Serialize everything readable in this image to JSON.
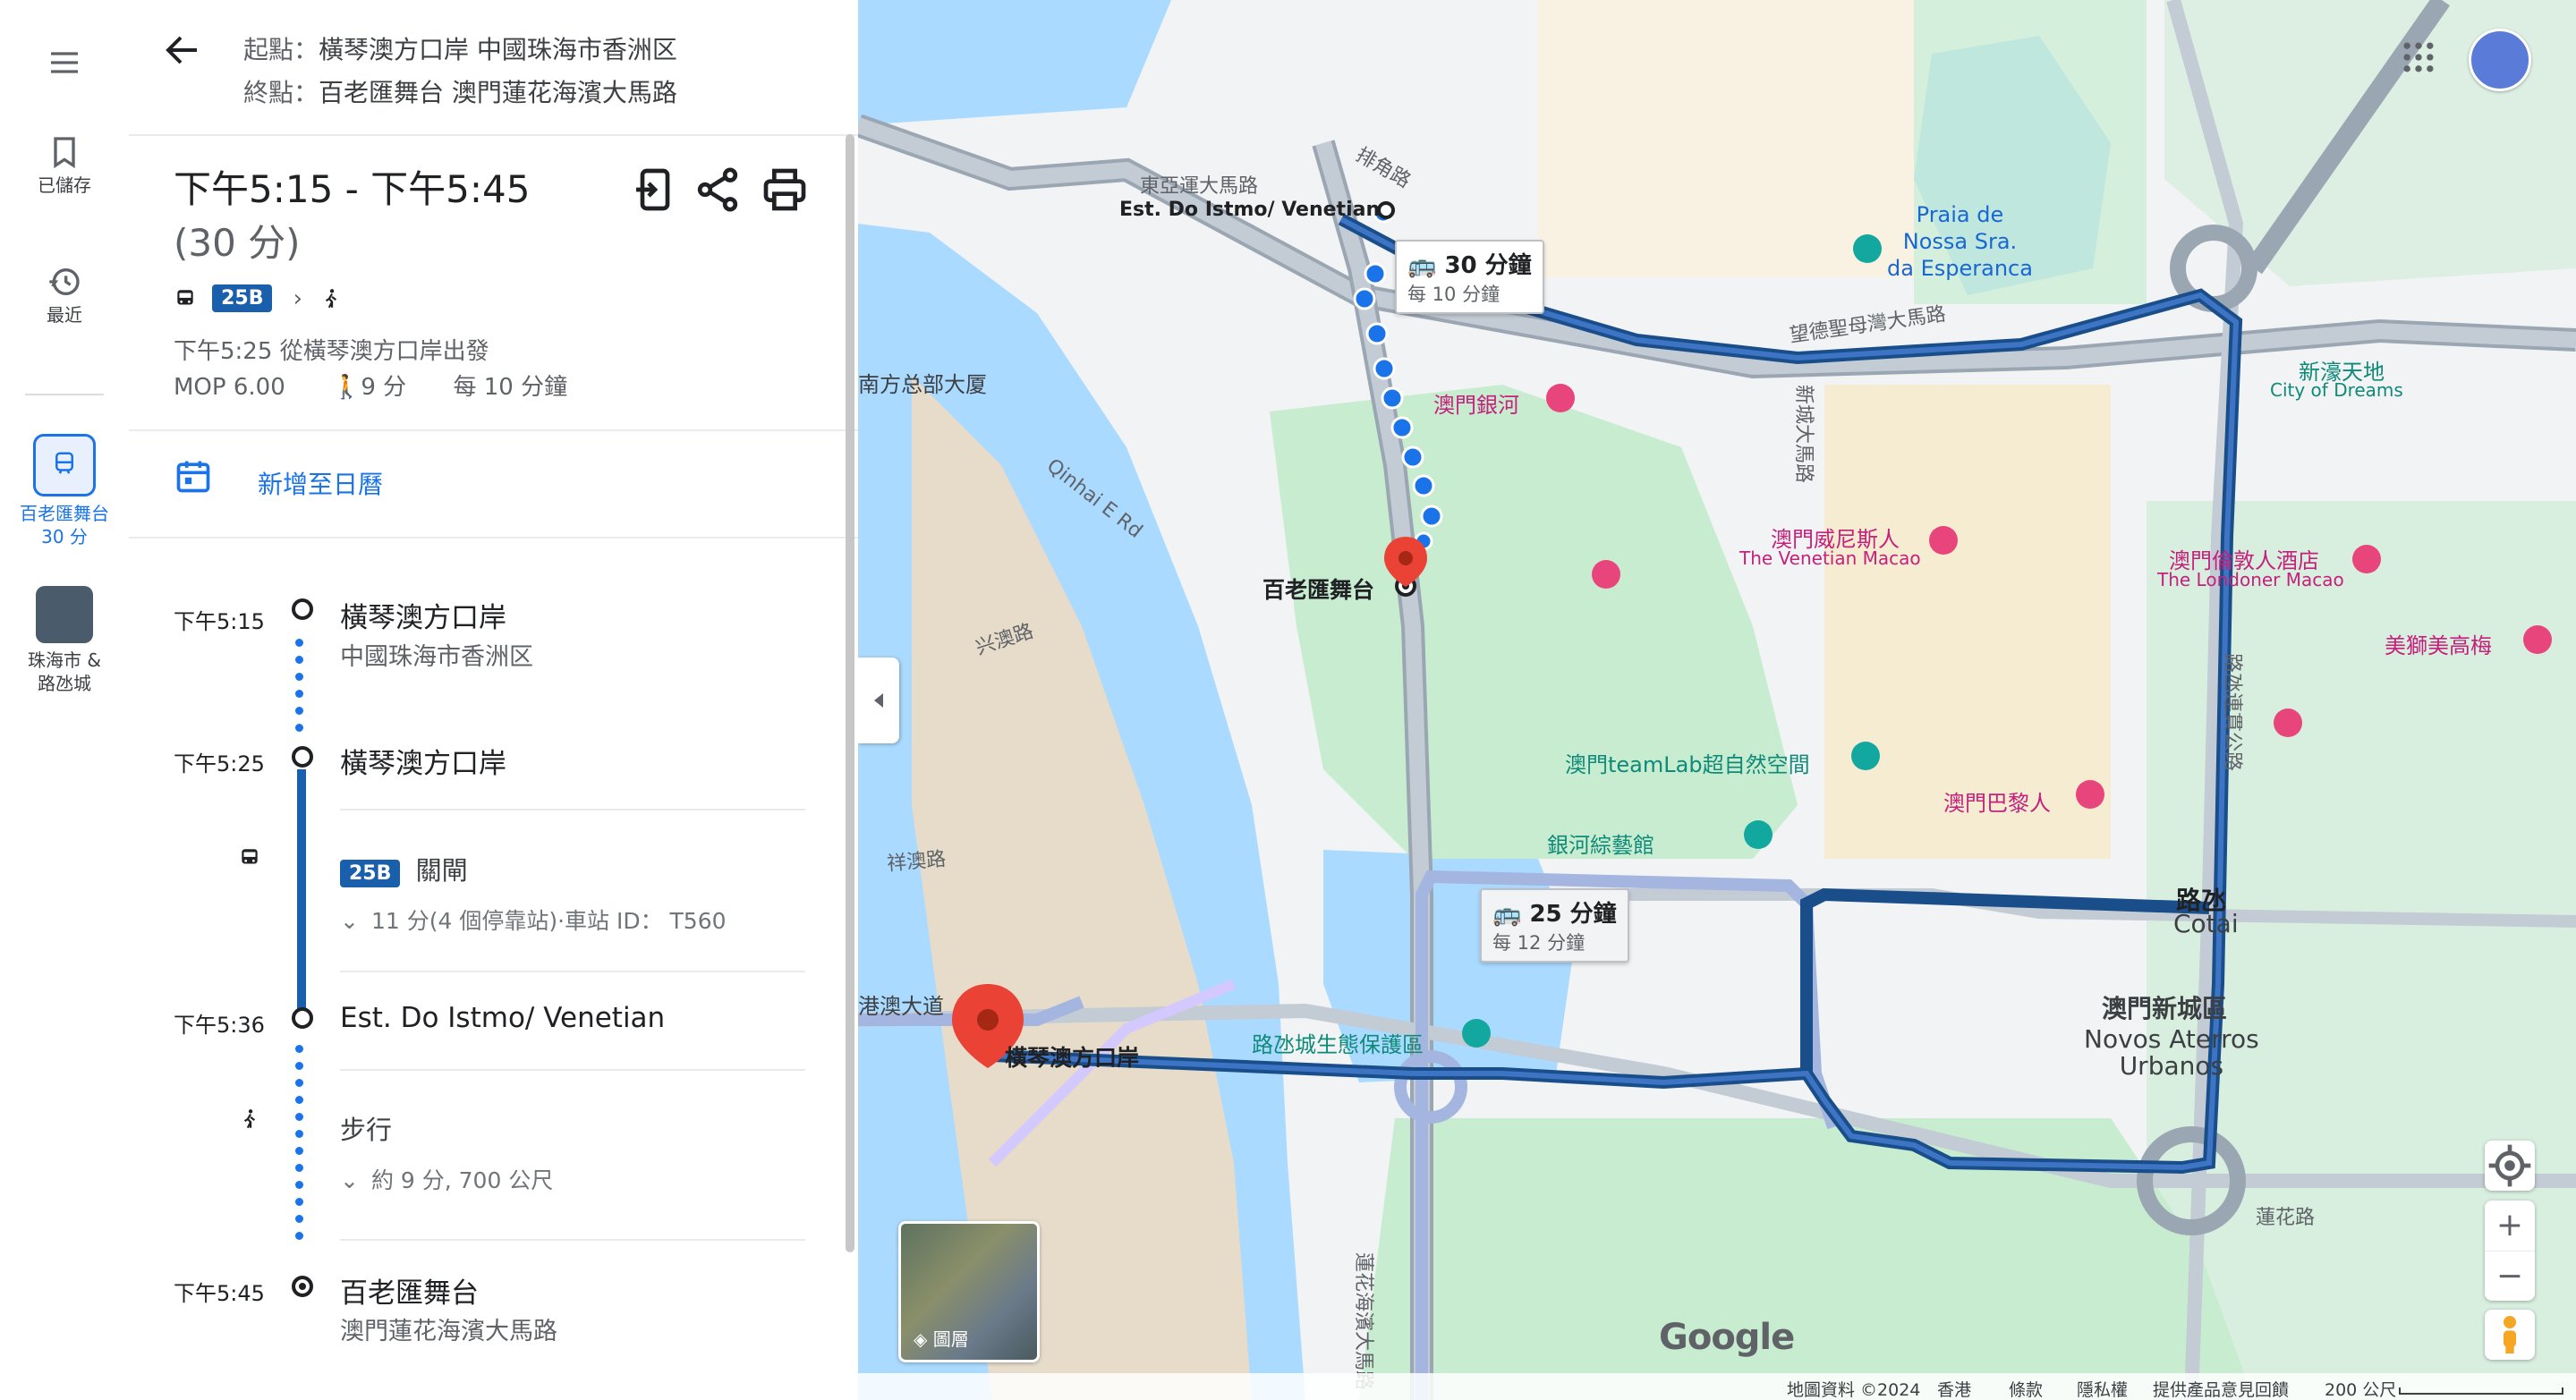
{
  "rail": {
    "menu_icon": "menu-icon",
    "saved_label": "已儲存",
    "recent_label": "最近",
    "active_trip_label": "百老匯舞台",
    "active_trip_sub": "30 分",
    "area_label": "珠海市 &\n路氹城"
  },
  "header": {
    "origin_prefix": "起點：",
    "origin": "橫琴澳方口岸 中國珠海市香洲区",
    "dest_prefix": "終點：",
    "destination": "百老匯舞台 澳門蓮花海濱大馬路"
  },
  "summary": {
    "time_range": "下午5:15 - 下午5:45",
    "duration": "(30 分)",
    "bus_route": "25B",
    "depart_text": "下午5:25 從橫琴澳方口岸出發",
    "fare": "MOP 6.00",
    "walk": "9 分",
    "frequency": "每 10 分鐘"
  },
  "calendar": {
    "label": "新增至日曆"
  },
  "timeline": {
    "t1_time": "下午5:15",
    "t1_name": "橫琴澳方口岸",
    "t1_sub": "中國珠海市香洲区",
    "t2_time": "下午5:25",
    "t2_name": "橫琴澳方口岸",
    "bus_badge": "25B",
    "bus_dir": "關閘",
    "bus_detail": "11 分(4 個停靠站)·車站 ID： T560",
    "t3_time": "下午5:36",
    "t3_name": "Est. Do Istmo/ Venetian",
    "walk_label": "步行",
    "walk_detail": "約 9 分, 700 公尺",
    "t4_time": "下午5:45",
    "t4_name": "百老匯舞台",
    "t4_sub": "澳門蓮花海濱大馬路"
  },
  "map": {
    "labels": {
      "east_asia_rd": "東亞運大馬路",
      "pai_jiao": "排角路",
      "est_istmo": "Est. Do Istmo/ Venetian",
      "praia": "Praia de\nNossa Sra.\nda Esperanca",
      "nanfang": "南方总部大厦",
      "galaxy": "澳門銀河",
      "xinhao_cn": "新濠天地",
      "xinhao_en": "City of Dreams",
      "qinhai": "Qinhai E Rd",
      "xinxing": "兴澳路",
      "broadway": "百老匯舞台",
      "venetian_cn": "澳門威尼斯人",
      "venetian_en": "The Venetian Macao",
      "londoner_cn": "澳門倫敦人酒店",
      "londoner_en": "The Londoner Macao",
      "meishi": "美獅美高梅",
      "teamlab": "澳門teamLab超自然空間",
      "paris": "澳門巴黎人",
      "galaxy_arts": "銀河綜藝館",
      "xiangao": "祥澳路",
      "cotai_cn": "路氹",
      "cotai_en": "Cotai",
      "gangao": "港澳大道",
      "hengqin": "橫琴澳方口岸",
      "eco": "路氹城生態保護區",
      "novos_cn": "澳門新城區",
      "novos_en": "Novos Aterros\nUrbanos",
      "lianhua": "蓮花路",
      "lianhua_coast": "蓮花海濱大馬路",
      "wangde": "望德聖母灣大馬路",
      "cotai_link": "路氹連貫公路",
      "xincheng": "新城大馬路",
      "layers": "圖層"
    },
    "callout_bus": {
      "time": "30 分鐘",
      "freq": "每 10 分鐘"
    },
    "callout_alt": {
      "time": "25 分鐘",
      "freq": "每 12 分鐘"
    },
    "footer": {
      "data": "地圖資料 ©2024",
      "region": "香港",
      "terms": "條款",
      "privacy": "隱私權",
      "feedback": "提供產品意見回饋",
      "scale": "200 公尺"
    },
    "google": "Google",
    "colors": {
      "route": "#1a4e8a",
      "walk": "#1a73e8",
      "water": "#aadaff",
      "park": "#c8ecd0"
    }
  }
}
